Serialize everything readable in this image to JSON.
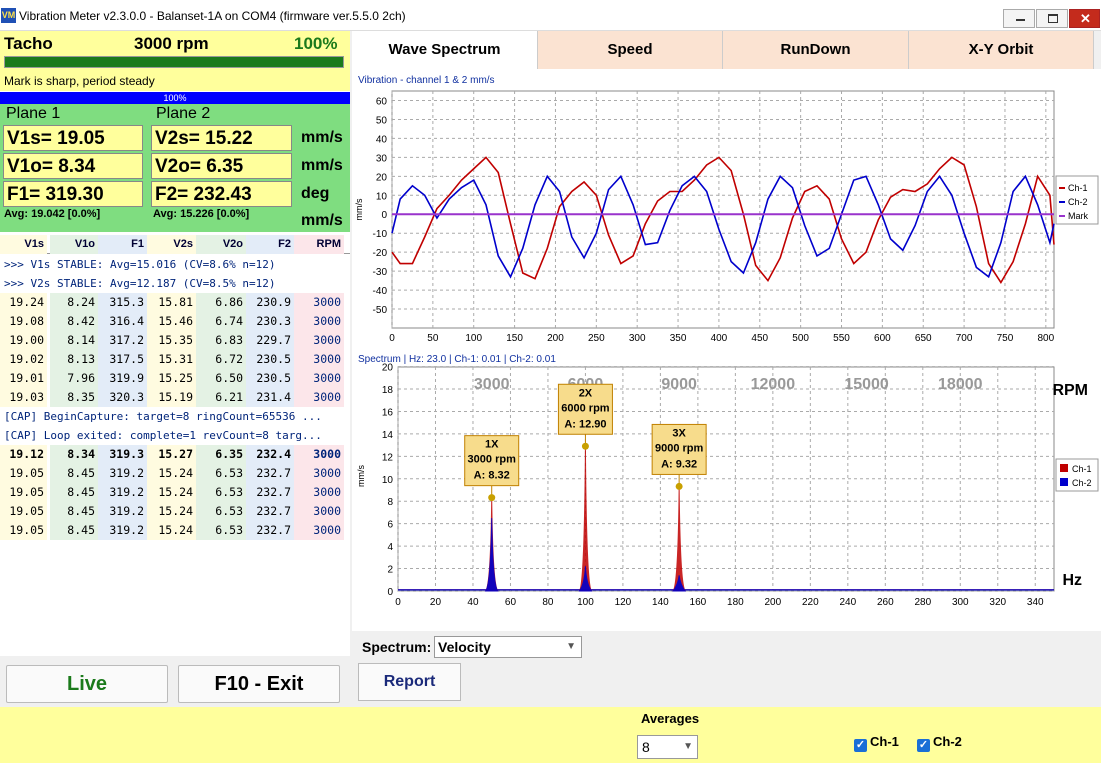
{
  "window": {
    "title": "Vibration Meter v2.3.0.0 - Balanset-1A on COM4 (firmware ver.5.5.0 2ch)",
    "icon": "app-logo-icon",
    "close_glyph": "✕"
  },
  "tacho": {
    "label": "Tacho",
    "rpm": "3000 rpm",
    "percent": "100%",
    "progress": 1.0,
    "status": "Mark is sharp, period steady",
    "bar_text": "100%"
  },
  "plane1": {
    "title": "Plane 1",
    "v1s": "V1s= 19.05",
    "v1o": "V1o= 8.34",
    "f1": "F1= 319.30",
    "avg": "Avg: 19.042 [0.0%]"
  },
  "plane2": {
    "title": "Plane 2",
    "v2s": "V2s= 15.22",
    "v2o": "V2o= 6.35",
    "f2": "F2= 232.43",
    "avg": "Avg: 15.226 [0.0%]"
  },
  "units": [
    "mm/s",
    "mm/s",
    "deg",
    "mm/s"
  ],
  "table": {
    "headers": [
      "V1s",
      "V1o",
      "F1",
      "V2s",
      "V2o",
      "F2",
      "RPM"
    ],
    "msgs": [
      ">>> V1s STABLE: Avg=15.016 (CV=8.6% n=12)",
      ">>> V2s STABLE: Avg=12.187 (CV=8.5% n=12)"
    ],
    "rows1": [
      [
        "19.24",
        "8.24",
        "315.3",
        "15.81",
        "6.86",
        "230.9",
        "3000"
      ],
      [
        "19.08",
        "8.42",
        "316.4",
        "15.46",
        "6.74",
        "230.3",
        "3000"
      ],
      [
        "19.00",
        "8.14",
        "317.2",
        "15.35",
        "6.83",
        "229.7",
        "3000"
      ],
      [
        "19.02",
        "8.13",
        "317.5",
        "15.31",
        "6.72",
        "230.5",
        "3000"
      ],
      [
        "19.01",
        "7.96",
        "319.9",
        "15.25",
        "6.50",
        "230.5",
        "3000"
      ],
      [
        "19.03",
        "8.35",
        "320.3",
        "15.19",
        "6.21",
        "231.4",
        "3000"
      ]
    ],
    "msgs2": [
      "[CAP] BeginCapture: target=8 ringCount=65536 ...",
      "[CAP] Loop exited: complete=1 revCount=8 targ..."
    ],
    "rows2": [
      [
        "19.12",
        "8.34",
        "319.3",
        "15.27",
        "6.35",
        "232.4",
        "3000"
      ],
      [
        "19.05",
        "8.45",
        "319.2",
        "15.24",
        "6.53",
        "232.7",
        "3000"
      ],
      [
        "19.05",
        "8.45",
        "319.2",
        "15.24",
        "6.53",
        "232.7",
        "3000"
      ],
      [
        "19.05",
        "8.45",
        "319.2",
        "15.24",
        "6.53",
        "232.7",
        "3000"
      ],
      [
        "19.05",
        "8.45",
        "319.2",
        "15.24",
        "6.53",
        "232.7",
        "3000"
      ]
    ]
  },
  "buttons": {
    "live": "Live",
    "exit": "F10 - Exit",
    "report": "Report"
  },
  "tabs": [
    "Wave Spectrum",
    "Speed",
    "RunDown",
    "X-Y Orbit"
  ],
  "spectrum_control": {
    "label": "Spectrum:",
    "value": "Velocity"
  },
  "averages": {
    "label": "Averages",
    "value": "8"
  },
  "checkboxes": [
    {
      "label": "Ch-1",
      "checked": true
    },
    {
      "label": "Ch-2",
      "checked": true
    }
  ],
  "chart_data": [
    {
      "type": "line",
      "title": "Vibration  - channel 1 & 2 mm/s",
      "ylabel": "mm/s",
      "xlim": [
        0,
        810
      ],
      "ylim": [
        -60,
        65
      ],
      "xticks": [
        0,
        50,
        100,
        150,
        200,
        250,
        300,
        350,
        400,
        450,
        500,
        550,
        600,
        650,
        700,
        750,
        800
      ],
      "yticks": [
        60,
        50,
        40,
        30,
        20,
        10,
        0,
        -10,
        -20,
        -30,
        -40,
        -50
      ],
      "grid": true,
      "legend_position": "right",
      "series": [
        {
          "name": "Ch-1",
          "color": "#c00000",
          "x": [
            0,
            10,
            25,
            40,
            55,
            70,
            85,
            100,
            115,
            130,
            145,
            160,
            175,
            190,
            205,
            220,
            235,
            250,
            265,
            280,
            295,
            310,
            325,
            340,
            355,
            370,
            385,
            400,
            415,
            430,
            445,
            460,
            475,
            490,
            505,
            520,
            535,
            550,
            565,
            580,
            595,
            610,
            625,
            640,
            655,
            670,
            685,
            700,
            715,
            730,
            745,
            760,
            775,
            790,
            805,
            810
          ],
          "y": [
            -20,
            -26,
            -26,
            -12,
            3,
            10,
            18,
            24,
            30,
            22,
            -5,
            -31,
            -34,
            -18,
            4,
            12,
            17,
            10,
            -11,
            -26,
            -22,
            -5,
            7,
            12,
            12,
            18,
            26,
            30,
            23,
            0,
            -27,
            -35,
            -23,
            -2,
            12,
            15,
            8,
            -13,
            -26,
            -20,
            -3,
            9,
            13,
            12,
            16,
            24,
            30,
            26,
            4,
            -26,
            -36,
            -25,
            -5,
            20,
            10,
            -16
          ]
        },
        {
          "name": "Ch-2",
          "color": "#0000cc",
          "x": [
            0,
            10,
            25,
            40,
            55,
            70,
            85,
            100,
            115,
            130,
            145,
            160,
            175,
            190,
            205,
            220,
            235,
            250,
            265,
            280,
            295,
            310,
            325,
            340,
            355,
            370,
            385,
            400,
            415,
            430,
            445,
            460,
            475,
            490,
            505,
            520,
            535,
            550,
            565,
            580,
            595,
            610,
            625,
            640,
            655,
            670,
            685,
            700,
            715,
            730,
            745,
            760,
            775,
            790,
            805,
            810
          ],
          "y": [
            -10,
            8,
            15,
            10,
            -2,
            8,
            14,
            18,
            5,
            -22,
            -33,
            -18,
            5,
            20,
            12,
            -12,
            -23,
            -10,
            13,
            20,
            5,
            -16,
            -15,
            2,
            15,
            20,
            12,
            -8,
            -25,
            -31,
            -15,
            8,
            20,
            14,
            -6,
            -22,
            -18,
            0,
            18,
            20,
            5,
            -13,
            -19,
            -6,
            12,
            20,
            10,
            -10,
            -28,
            -33,
            -15,
            12,
            20,
            5,
            -15,
            -5
          ]
        },
        {
          "name": "Mark",
          "color": "#9933cc",
          "x": [
            0,
            810
          ],
          "y": [
            0,
            0
          ]
        }
      ]
    },
    {
      "type": "line",
      "title": "Spectrum | Hz: 23.0 | Ch-1: 0.01 | Ch-2: 0.01",
      "ylabel": "mm/s",
      "xlabel": "Hz",
      "x2label": "RPM",
      "xlim": [
        0,
        350
      ],
      "ylim": [
        0,
        20.5
      ],
      "xticks": [
        0,
        20,
        40,
        60,
        80,
        100,
        120,
        140,
        160,
        180,
        200,
        220,
        240,
        260,
        280,
        300,
        320,
        340
      ],
      "yticks": [
        0,
        2,
        4,
        6,
        8,
        10,
        12,
        14,
        16,
        18,
        20
      ],
      "rpm_ticks": [
        {
          "hz": 50,
          "label": "3000"
        },
        {
          "hz": 100,
          "label": "6000"
        },
        {
          "hz": 150,
          "label": "9000"
        },
        {
          "hz": 200,
          "label": "12000"
        },
        {
          "hz": 250,
          "label": "15000"
        },
        {
          "hz": 300,
          "label": "18000"
        }
      ],
      "grid": true,
      "legend_position": "right",
      "series": [
        {
          "name": "Ch-1",
          "color": "#c00000",
          "peaks": [
            {
              "hz": 50,
              "value": 8.32
            },
            {
              "hz": 100,
              "value": 12.9
            },
            {
              "hz": 150,
              "value": 9.32
            }
          ]
        },
        {
          "name": "Ch-2",
          "color": "#0000cc",
          "peaks": [
            {
              "hz": 50,
              "value": 6.5
            },
            {
              "hz": 100,
              "value": 2.2
            },
            {
              "hz": 150,
              "value": 1.4
            }
          ]
        }
      ],
      "annotations": [
        {
          "hz": 50,
          "value": 8.32,
          "line1": "1X",
          "line2": "3000 rpm",
          "line3": "A: 8.32"
        },
        {
          "hz": 100,
          "value": 12.9,
          "line1": "2X",
          "line2": "6000 rpm",
          "line3": "A: 12.90"
        },
        {
          "hz": 150,
          "value": 9.32,
          "line1": "3X",
          "line2": "9000 rpm",
          "line3": "A: 9.32"
        }
      ]
    }
  ]
}
